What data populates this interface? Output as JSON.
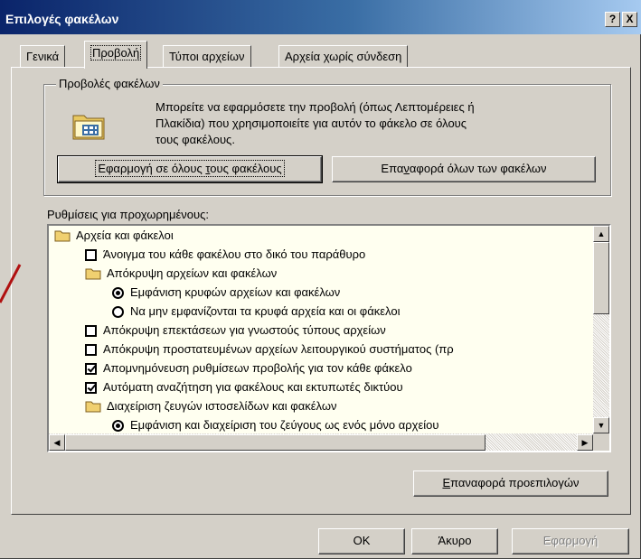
{
  "window": {
    "title": "Επιλογές φακέλων",
    "help_label": "?",
    "close_label": "X"
  },
  "tabs": [
    {
      "label": "Γενικά",
      "active": false
    },
    {
      "label": "Προβολή",
      "active": true
    },
    {
      "label": "Τύποι αρχείων",
      "active": false
    },
    {
      "label": "Αρχεία χωρίς σύνδεση",
      "active": false
    }
  ],
  "folder_views": {
    "group_label": "Προβολές φακέλων",
    "description": [
      "Μπορείτε να εφαρμόσετε την προβολή (όπως Λεπτομέρειες ή",
      "Πλακίδια) που χρησιμοποιείτε για αυτόν το φάκελο σε όλους",
      "τους φακέλους."
    ],
    "apply_all_pre": "Εφαρμογή σε όλους ",
    "apply_all_u": "τ",
    "apply_all_post": "ους φακέλους",
    "reset_all_pre": "Επα",
    "reset_all_u": "ν",
    "reset_all_post": "αφορά όλων των φακέλων"
  },
  "advanced": {
    "label": "Ρυθμίσεις για προχωρημένους:",
    "items": [
      {
        "type": "folder",
        "label": "Αρχεία και φάκελοι"
      },
      {
        "type": "checkbox",
        "checked": false,
        "label": "Άνοιγμα του κάθε φακέλου στο δικό του παράθυρο"
      },
      {
        "type": "folder",
        "label": "Απόκρυψη αρχείων και φακέλων"
      },
      {
        "type": "radio",
        "checked": true,
        "label": "Εμφάνιση κρυφών αρχείων και φακέλων"
      },
      {
        "type": "radio",
        "checked": false,
        "label": "Να μην εμφανίζονται τα κρυφά αρχεία και οι φάκελοι"
      },
      {
        "type": "checkbox",
        "checked": false,
        "label": "Απόκρυψη επεκτάσεων για γνωστούς τύπους αρχείων"
      },
      {
        "type": "checkbox",
        "checked": false,
        "label": "Απόκρυψη προστατευμένων αρχείων λειτουργικού συστήματος (πρ"
      },
      {
        "type": "checkbox",
        "checked": true,
        "label": "Απομνημόνευση ρυθμίσεων προβολής για τον κάθε φάκελο"
      },
      {
        "type": "checkbox",
        "checked": true,
        "label": "Αυτόματη αναζήτηση για φακέλους και εκτυπωτές δικτύου"
      },
      {
        "type": "folder",
        "label": "Διαχείριση ζευγών ιστοσελίδων και φακέλων"
      },
      {
        "type": "radio",
        "checked": true,
        "label": "Εμφάνιση και διαχείριση του ζεύγους ως ενός μόνο αρχείου"
      }
    ]
  },
  "restore_defaults_u": "Ε",
  "restore_defaults_post": "παναφορά προεπιλογών",
  "footer": {
    "ok": "OK",
    "cancel": "Άκυρο",
    "apply": "Εφαρμογή"
  },
  "colors": {
    "title_start": "#0a246a",
    "title_end": "#a6caf0",
    "face": "#d4d0c8",
    "list_bg": "#fffff0",
    "annotation_red": "#b01010"
  },
  "icons": {
    "folder_views": "folder-view-icon",
    "group": "folder-icon",
    "scroll_up": "arrow-up-icon",
    "scroll_down": "arrow-down-icon",
    "scroll_left": "arrow-left-icon",
    "scroll_right": "arrow-right-icon"
  }
}
